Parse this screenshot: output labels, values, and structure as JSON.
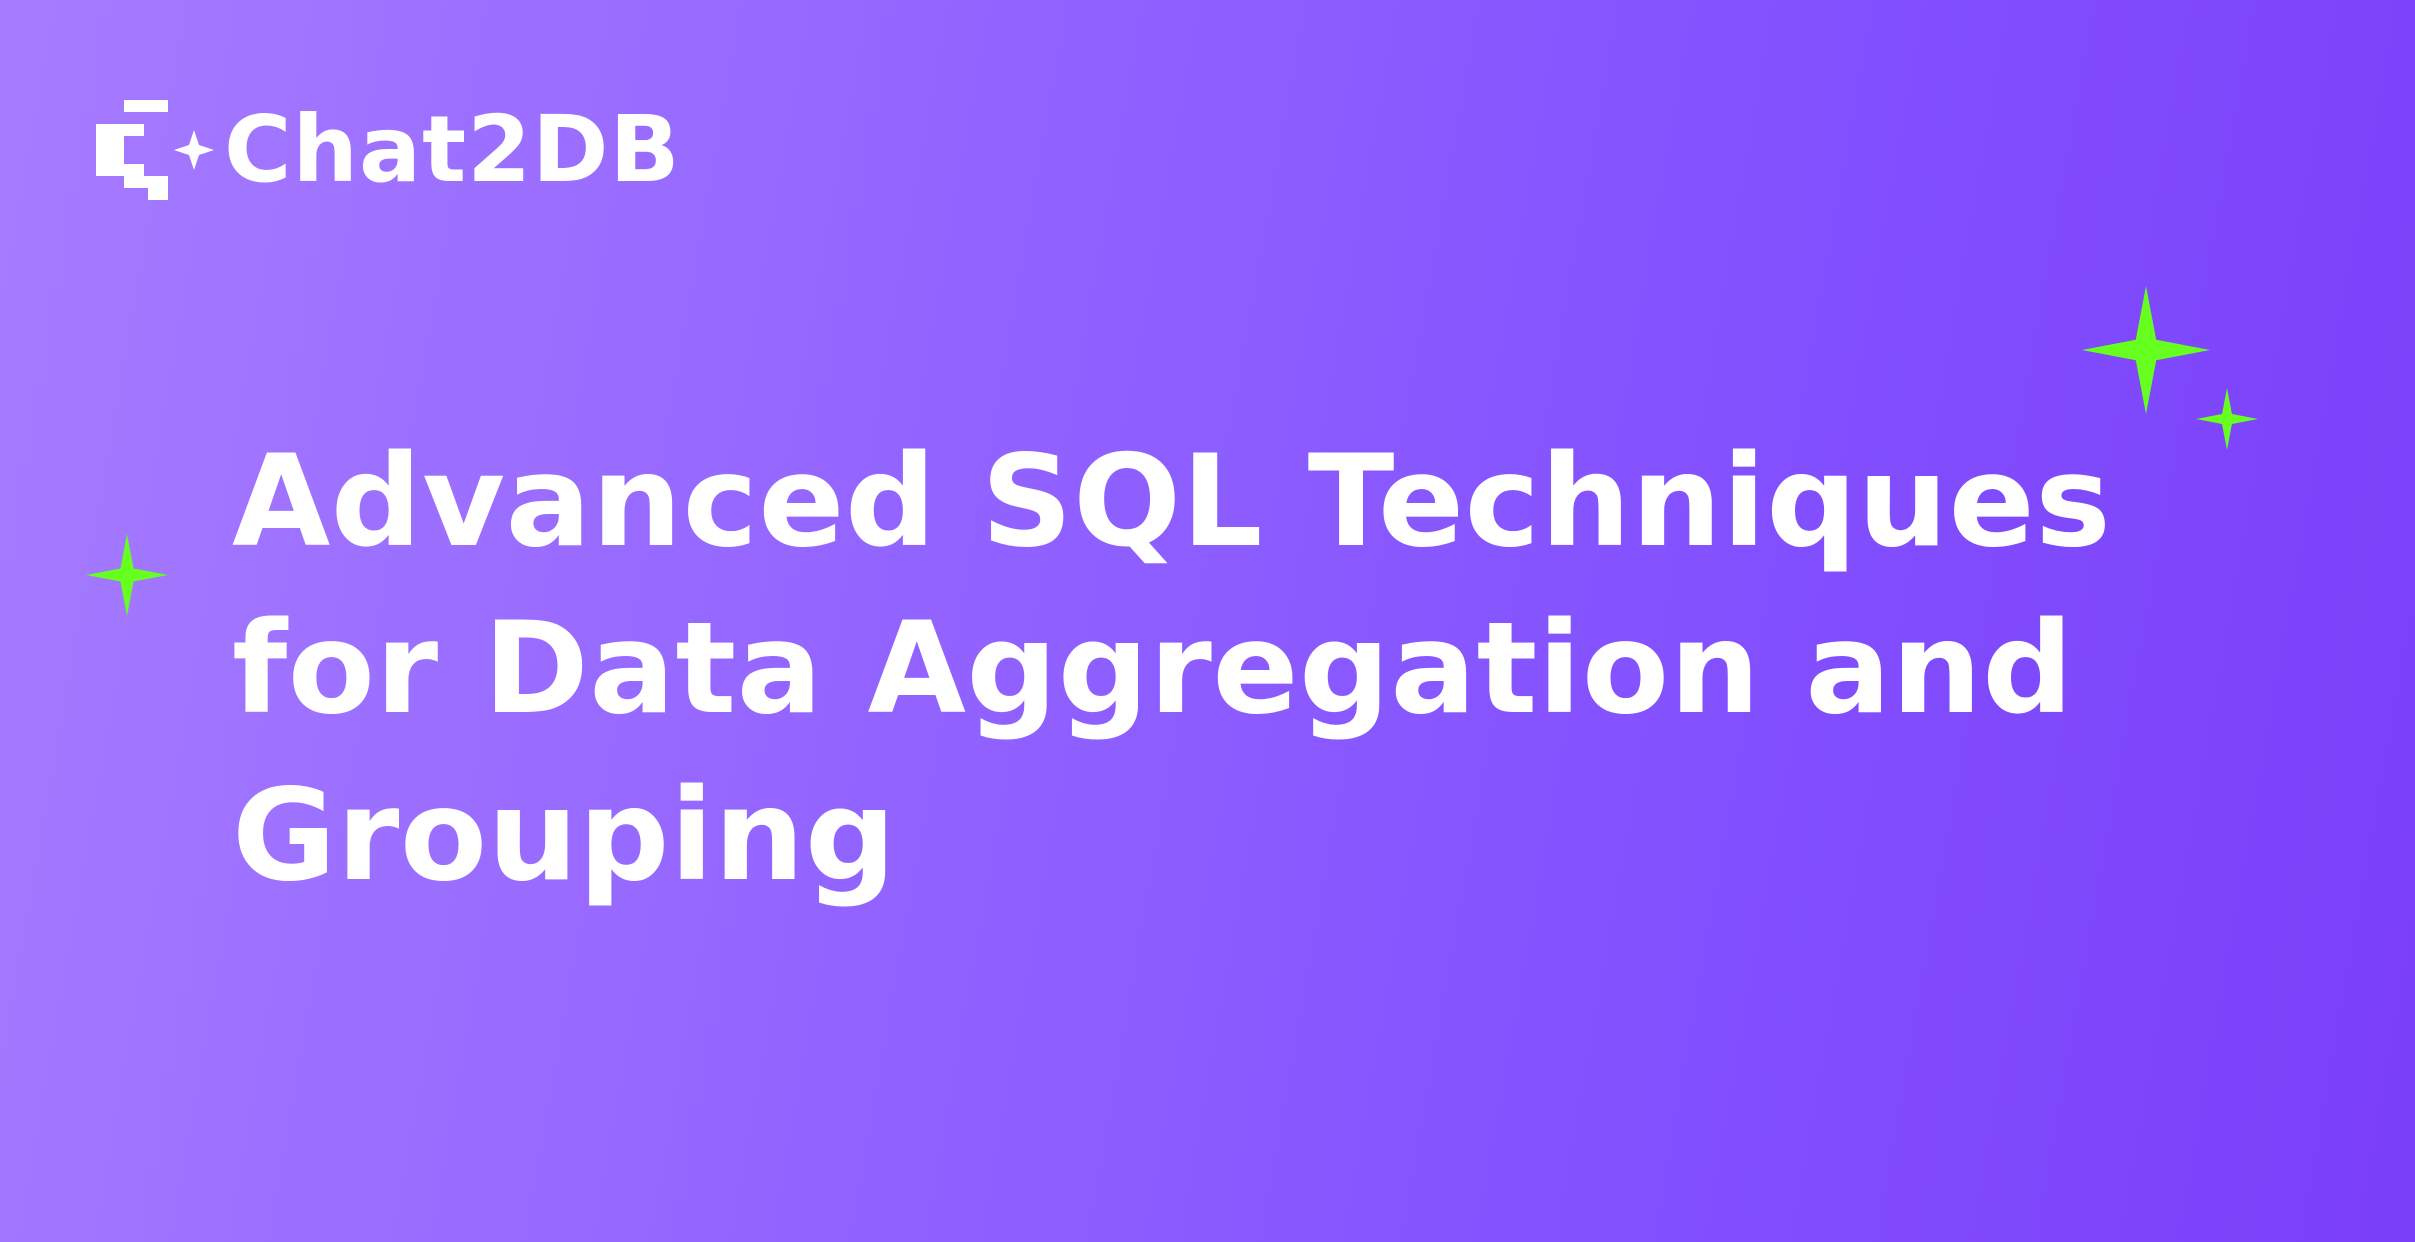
{
  "brand": {
    "name": "Chat2DB",
    "logo_icon": "chat2db-logo-icon"
  },
  "headline": {
    "lines": [
      "Advanced SQL Techniques",
      "for Data Aggregation and",
      "Grouping"
    ]
  },
  "decorations": {
    "sparkle_icon": "sparkle-icon",
    "sparkle_color": "#66ff1f"
  },
  "colors": {
    "background_start": "#a67cff",
    "background_end": "#7a3ff8",
    "text": "#ffffff"
  }
}
